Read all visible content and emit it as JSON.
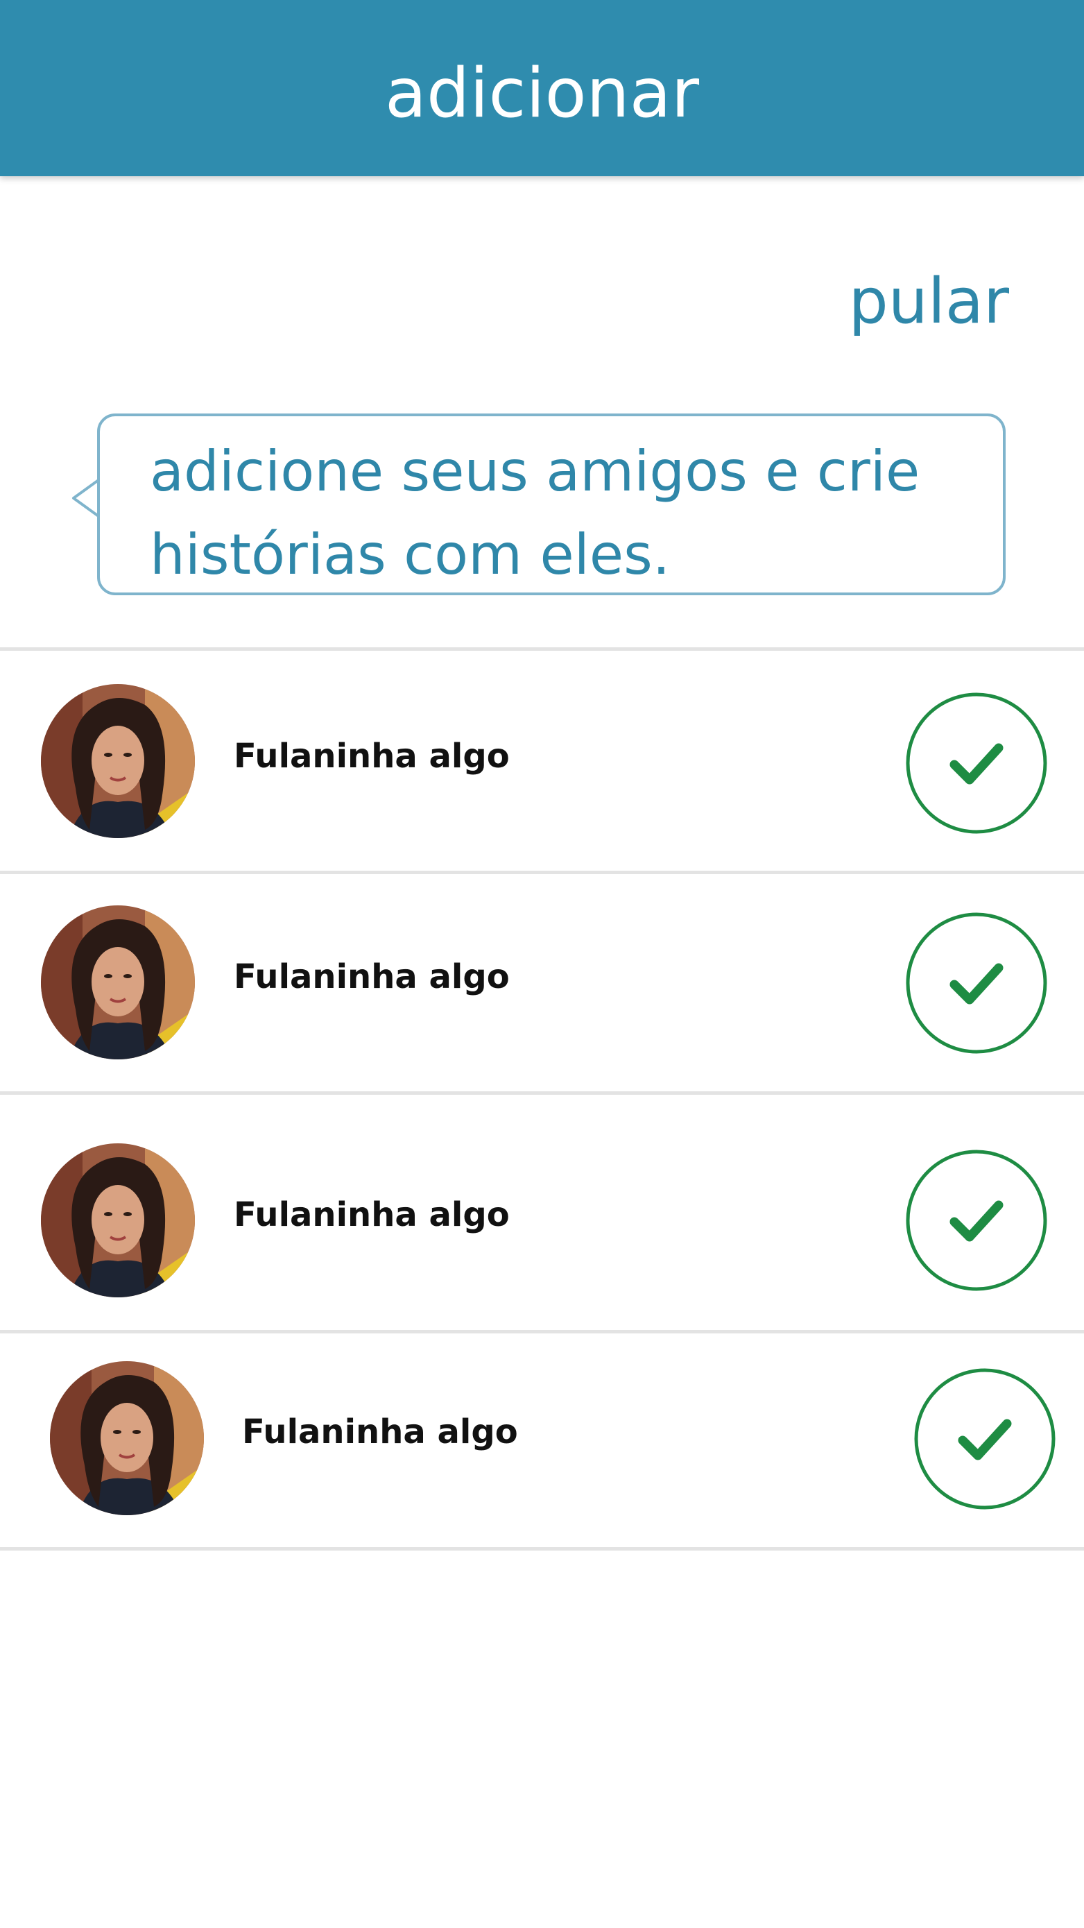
{
  "header": {
    "title": "adicionar"
  },
  "actions": {
    "skip_label": "pular"
  },
  "intro": {
    "message": "adicione seus amigos e crie histórias com eles."
  },
  "friends": [
    {
      "name": "Fulaninha algo",
      "selected": true
    },
    {
      "name": "Fulaninha algo",
      "selected": true
    },
    {
      "name": "Fulaninha algo",
      "selected": true
    },
    {
      "name": "Fulaninha algo",
      "selected": true
    }
  ],
  "icons": {
    "select": "check-circle-icon",
    "avatar": "profile-photo"
  },
  "colors": {
    "header_bg": "#2f8cae",
    "accent_text": "#2f87a9",
    "bubble_border": "#7fb4cc",
    "check_green": "#1e8c43",
    "divider": "#e3e3e3"
  }
}
